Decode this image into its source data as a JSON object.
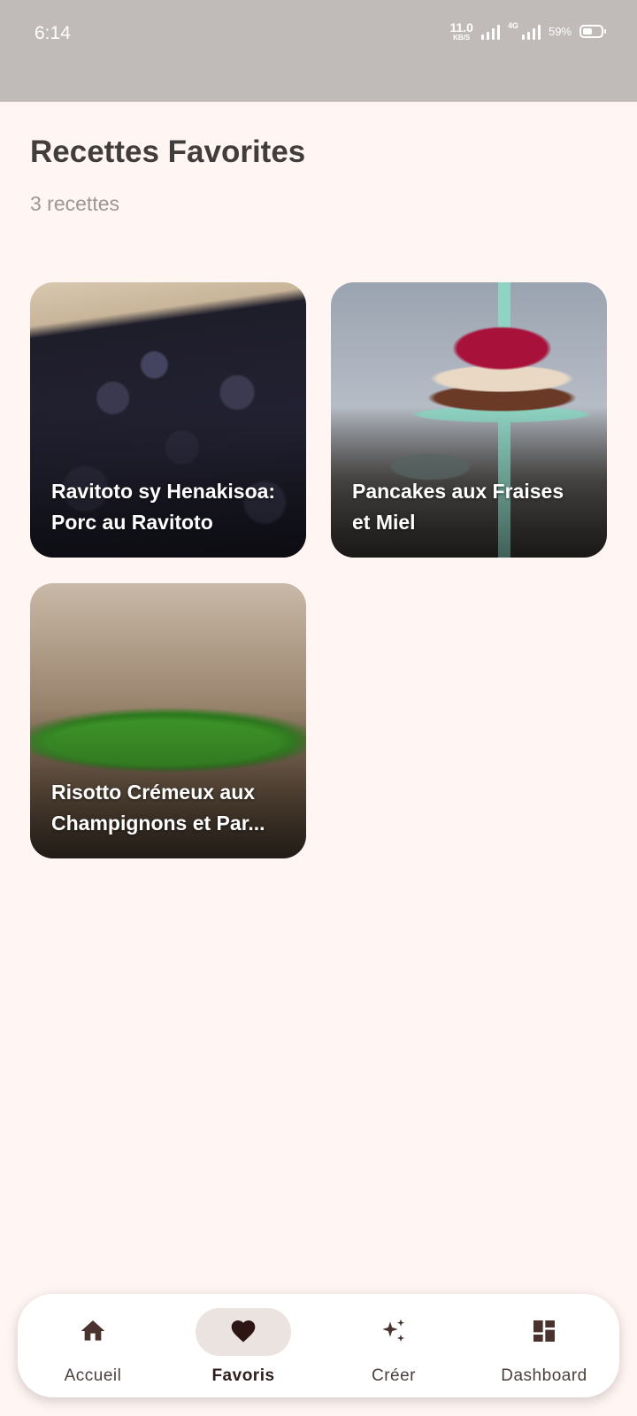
{
  "status_bar": {
    "time": "6:14",
    "net_speed_value": "11.0",
    "net_speed_unit": "KB/S",
    "network_type": "4G",
    "battery_percent": "59%"
  },
  "header": {
    "title": "Recettes Favorites",
    "subtitle": "3 recettes"
  },
  "recipes": [
    {
      "title": "Ravitoto sy Henakisoa: Porc au Ravitoto",
      "image": "blackberries-photo"
    },
    {
      "title": "Pancakes aux Fraises et Miel",
      "image": "layered-cake-photo"
    },
    {
      "title": "Risotto Crémeux aux Champignons et Par...",
      "image": "pea-pod-photo"
    }
  ],
  "bottom_nav": {
    "items": [
      {
        "label": "Accueil",
        "icon": "home-icon",
        "active": false
      },
      {
        "label": "Favoris",
        "icon": "heart-icon",
        "active": true
      },
      {
        "label": "Créer",
        "icon": "sparkle-icon",
        "active": false
      },
      {
        "label": "Dashboard",
        "icon": "dashboard-icon",
        "active": false
      }
    ]
  },
  "colors": {
    "background": "#fff5f3",
    "status_bar": "#c0bbb9",
    "title_text": "#403d3c",
    "subtitle_text": "#9b9796",
    "nav_active_pill": "#ebe3e0",
    "nav_icon": "#4a332f"
  }
}
